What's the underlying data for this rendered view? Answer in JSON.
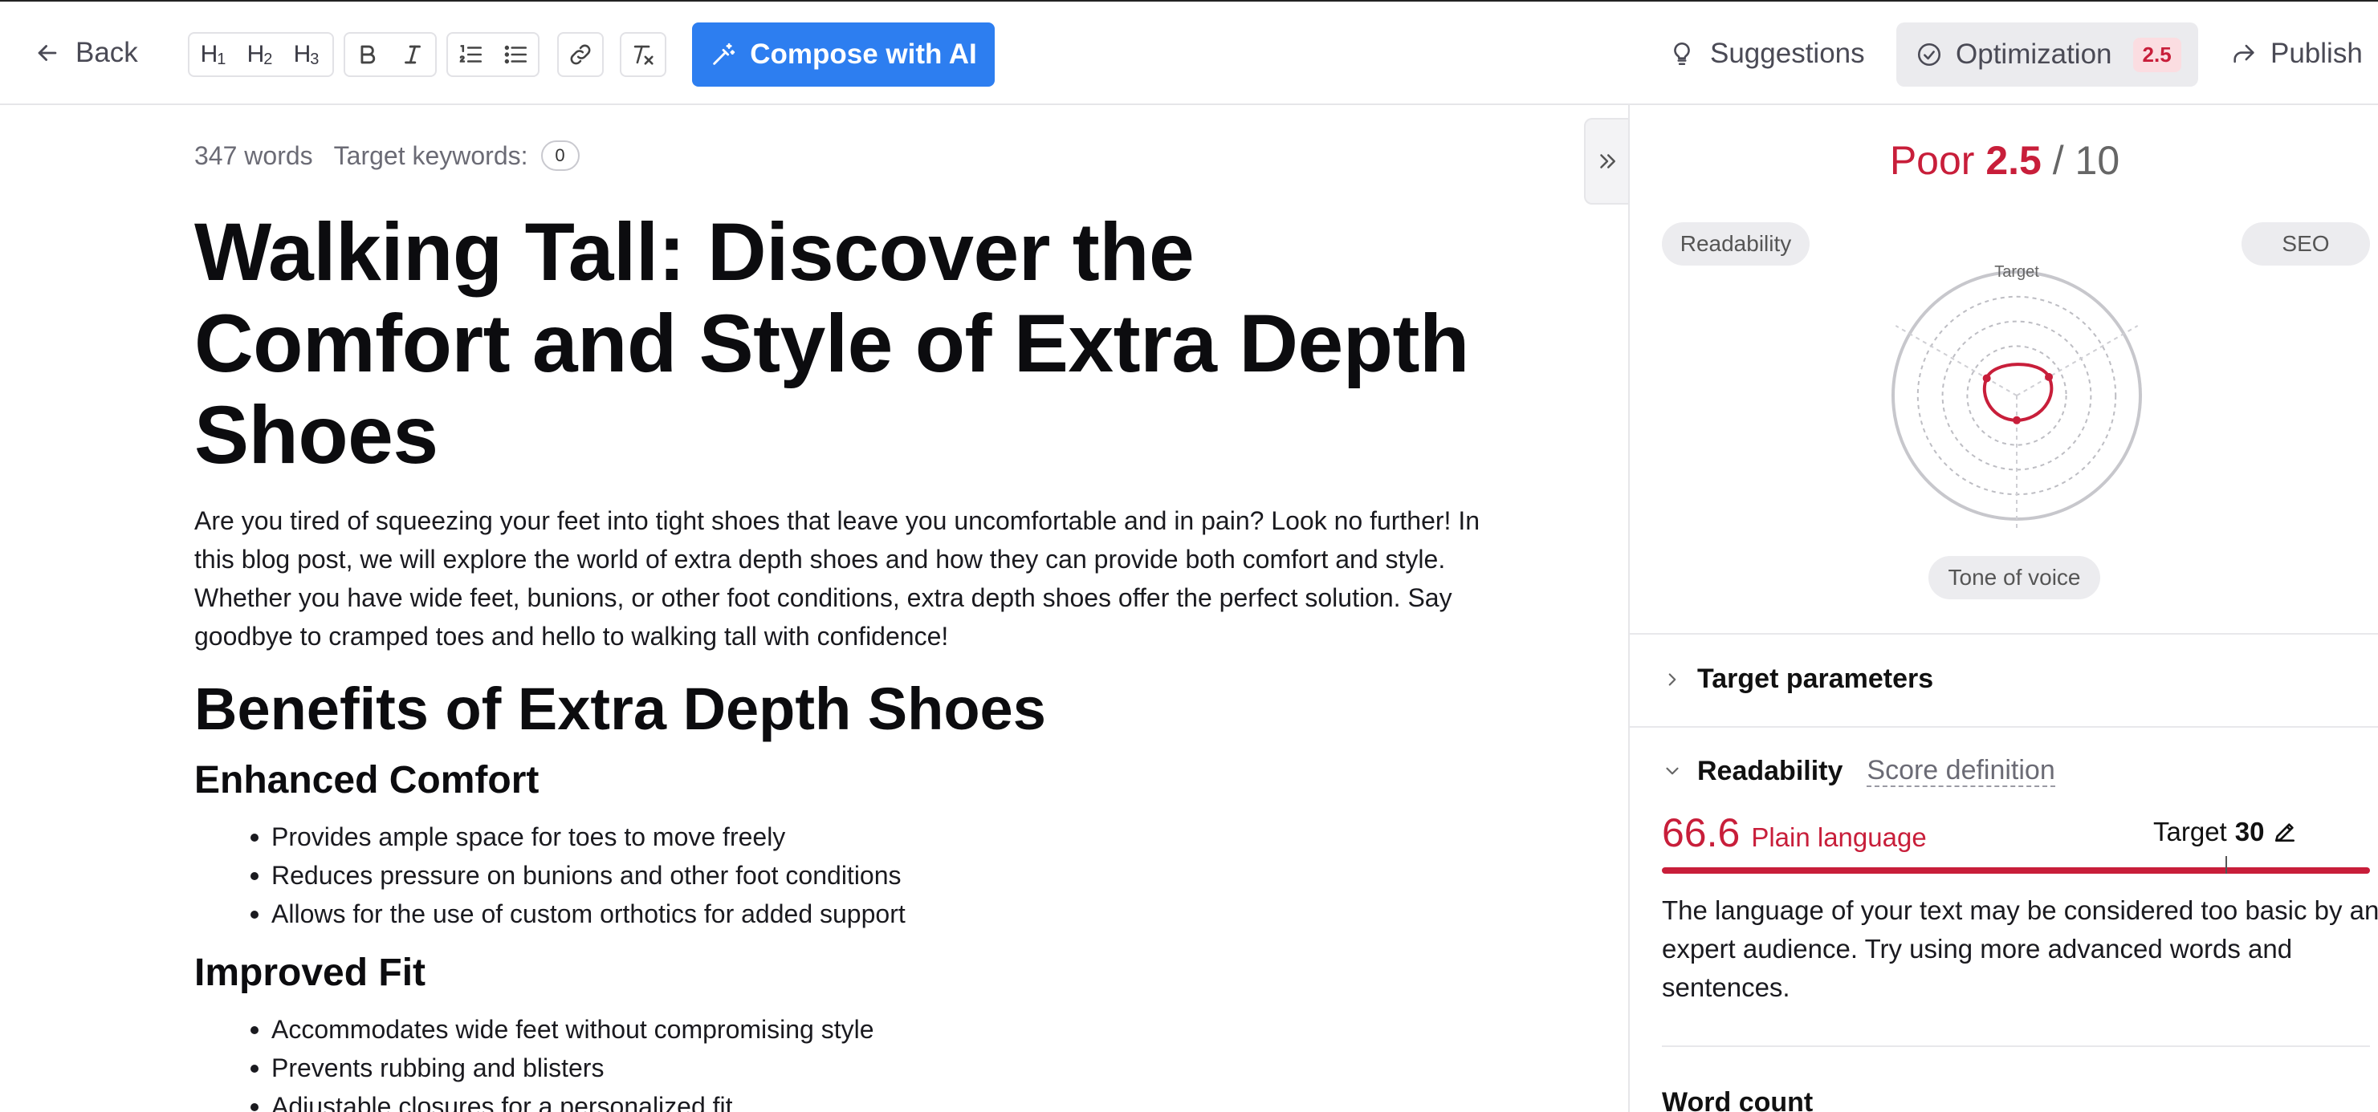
{
  "toolbar": {
    "back_label": "Back",
    "compose_label": "Compose with AI",
    "suggestions_label": "Suggestions",
    "optimization_label": "Optimization",
    "optimization_badge": "2.5",
    "publish_label": "Publish",
    "format_buttons": [
      "H1",
      "H2",
      "H3",
      "bold",
      "italic",
      "ordered-list",
      "bullet-list",
      "link",
      "clear-format"
    ],
    "icons": {
      "back": "arrow-left-icon",
      "compose": "magic-wand-icon",
      "suggestions": "lightbulb-icon",
      "optimization": "check-circle-icon",
      "publish": "share-arrow-icon"
    }
  },
  "editor": {
    "word_count": "347 words",
    "target_keywords_label": "Target keywords:",
    "target_keywords_count": "0",
    "title": "Walking Tall: Discover the Comfort and Style of Extra Depth Shoes",
    "intro": "Are you tired of squeezing your feet into tight shoes that leave you uncomfortable and in pain? Look no further! In this blog post, we will explore the world of extra depth shoes and how they can provide both comfort and style. Whether you have wide feet, bunions, or other foot conditions, extra depth shoes offer the perfect solution. Say goodbye to cramped toes and hello to walking tall with confidence!",
    "h2": "Benefits of Extra Depth Shoes",
    "sections": [
      {
        "heading": "Enhanced Comfort",
        "items": [
          "Provides ample space for toes to move freely",
          "Reduces pressure on bunions and other foot conditions",
          "Allows for the use of custom orthotics for added support"
        ]
      },
      {
        "heading": "Improved Fit",
        "items": [
          "Accommodates wide feet without compromising style",
          "Prevents rubbing and blisters",
          "Adjustable closures for a personalized fit"
        ]
      }
    ]
  },
  "panel": {
    "score_label": "Poor",
    "score_value": "2.5",
    "score_max": "/ 10",
    "pill_readability": "Readability",
    "pill_seo": "SEO",
    "pill_tone": "Tone of voice",
    "radar_target_label": "Target",
    "radar_values": {
      "readability": 0.28,
      "seo": 0.3,
      "tone_of_voice": 0.2
    },
    "target_parameters_label": "Target parameters",
    "readability_label": "Readability",
    "score_definition_label": "Score definition",
    "readability_score": "66.6",
    "readability_level": "Plain language",
    "target_label": "Target",
    "target_value": "30",
    "readability_description": "The language of your text may be considered too basic by an expert audience. Try using more advanced words and sentences.",
    "word_count_label": "Word count"
  },
  "colors": {
    "accent_blue": "#2d7ef0",
    "poor_red": "#c81e3a",
    "badge_bg": "#fbdde1"
  }
}
